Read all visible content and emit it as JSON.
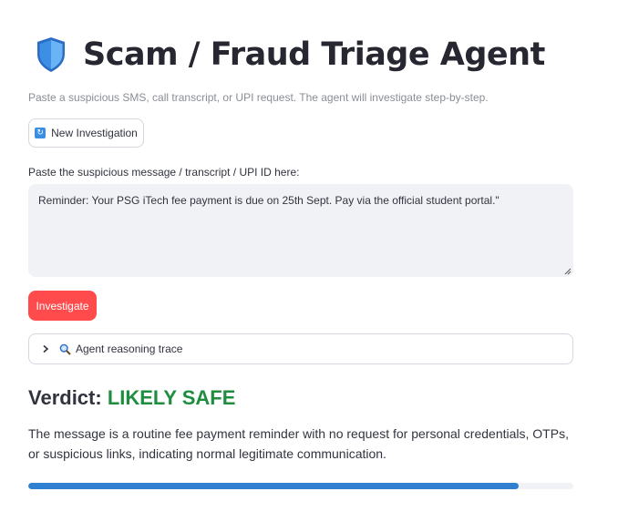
{
  "header": {
    "icon": "shield-icon",
    "title": "Scam / Fraud Triage Agent",
    "subtitle": "Paste a suspicious SMS, call transcript, or UPI request. The agent will investigate step-by-step."
  },
  "toolbar": {
    "new_investigation_icon": "refresh-icon",
    "new_investigation_label": "New Investigation"
  },
  "input": {
    "label": "Paste the suspicious message / transcript / UPI ID here:",
    "value": "Reminder: Your PSG iTech fee payment is due on 25th Sept. Pay via the official student portal.\""
  },
  "actions": {
    "investigate_label": "Investigate"
  },
  "trace": {
    "icon": "magnifier-icon",
    "label": "Agent reasoning trace",
    "expanded": false
  },
  "verdict": {
    "heading_prefix": "Verdict: ",
    "value": "LIKELY SAFE",
    "explanation": "The message is a routine fee payment reminder with no request for personal credentials, OTPs, or suspicious links, indicating normal legitimate communication.",
    "confidence_fraction": 0.9
  },
  "colors": {
    "accent": "#ff4b4b",
    "safe": "#1e8e3e",
    "progress": "#2f80d1",
    "shield": "#3b8ee0"
  }
}
